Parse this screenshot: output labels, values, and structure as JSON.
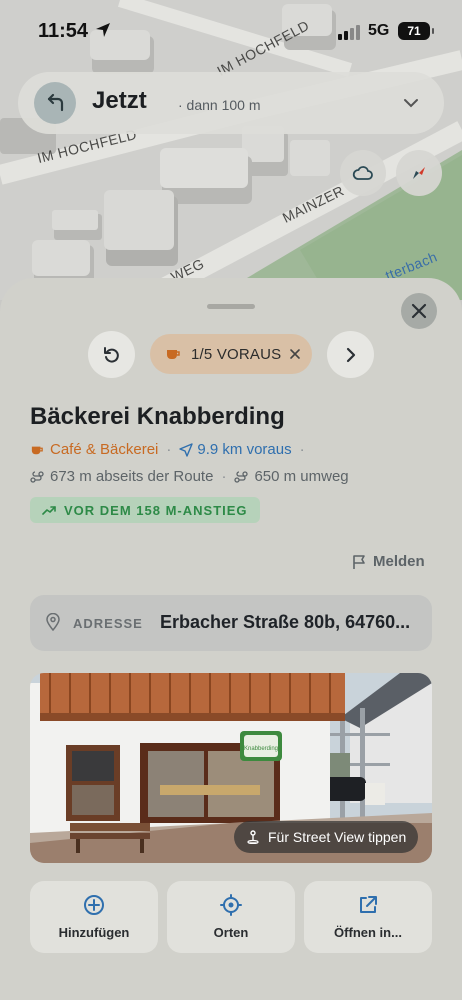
{
  "status_bar": {
    "time": "11:54",
    "network": "5G",
    "battery": "71"
  },
  "map": {
    "road_labels": [
      "IM HOCHFELD",
      "IM HOCHFELD",
      "MAINZER",
      "WEG",
      "tterbach"
    ]
  },
  "direction": {
    "title": "Jetzt",
    "subtitle": "· dann 100 m"
  },
  "nav": {
    "counter": "1/5 VORAUS"
  },
  "place": {
    "name": "Bäckerei Knabberding",
    "category": "Café & Bäckerei",
    "sep": "·",
    "distance": "9.9 km voraus",
    "off_route": "673 m abseits der Route",
    "detour": "650 m umweg",
    "climb_badge": "VOR DEM 158 M-ANSTIEG",
    "report": "Melden",
    "address_label": "ADRESSE",
    "address_value": "Erbacher Straße 80b, 64760..."
  },
  "photo": {
    "street_view": "Für Street View tippen",
    "sign_text": "Knabberding"
  },
  "actions": [
    {
      "label": "Hinzufügen",
      "icon": "plus-circle-icon"
    },
    {
      "label": "Orten",
      "icon": "locate-icon"
    },
    {
      "label": "Öffnen in...",
      "icon": "external-link-icon"
    }
  ],
  "colors": {
    "category": "#c86a22",
    "distance": "#2f6fae",
    "climb_text": "#2d8a47",
    "climb_bg": "#b6d2ba",
    "pill_bg": "#d9c0a6"
  }
}
